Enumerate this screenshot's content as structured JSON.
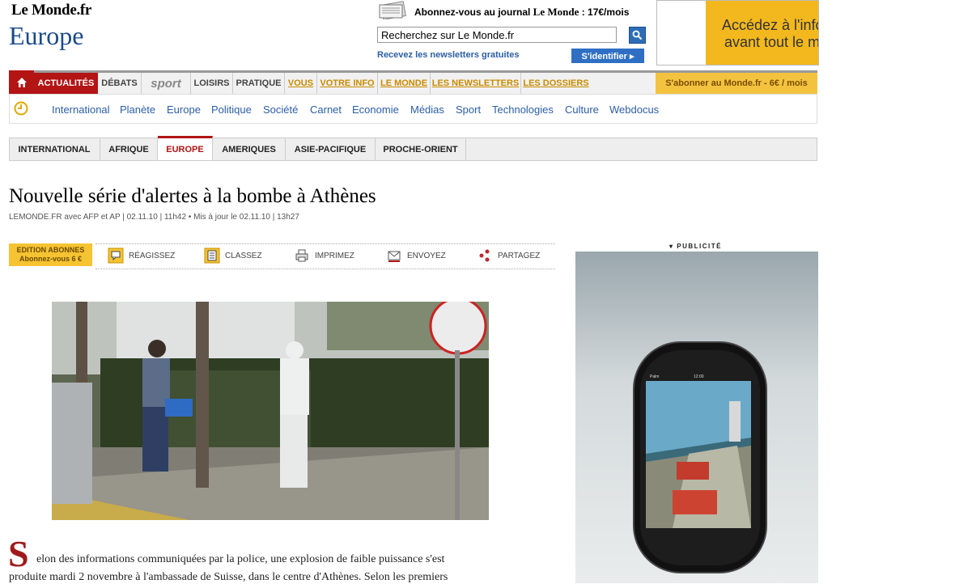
{
  "header": {
    "logo": "Le Monde.fr",
    "section_title": "Europe",
    "subscribe_text_pre": "Abonnez-vous au journal ",
    "subscribe_brand": "Le Monde",
    "subscribe_price": " : 17€/mois",
    "search_value": "Recherchez sur Le Monde.fr",
    "newsletters_link": "Recevez les newsletters gratuites",
    "signin_label": "S'identifier ▸",
    "ad_line1": "Accédez à l'info",
    "ad_line2": "avant tout le m"
  },
  "nav": {
    "items": [
      {
        "label": "ACTUALITÉS"
      },
      {
        "label": "DÉBATS"
      },
      {
        "label": "sport"
      },
      {
        "label": "LOISIRS"
      },
      {
        "label": "PRATIQUE"
      },
      {
        "label": "VOUS"
      },
      {
        "label": "VOTRE INFO"
      },
      {
        "label": "LE MONDE"
      },
      {
        "label": "LES NEWSLETTERS"
      },
      {
        "label": "LES DOSSIERS"
      }
    ],
    "subscribe_button": "S'abonner au Monde.fr - 6€ / mois"
  },
  "subnav": {
    "items": [
      "International",
      "Planète",
      "Europe",
      "Politique",
      "Société",
      "Carnet",
      "Economie",
      "Médias",
      "Sport",
      "Technologies",
      "Culture",
      "Webdocus"
    ]
  },
  "tabs": {
    "items": [
      "INTERNATIONAL",
      "AFRIQUE",
      "EUROPE",
      "AMERIQUES",
      "ASIE-PACIFIQUE",
      "PROCHE-ORIENT"
    ],
    "active": "EUROPE"
  },
  "article": {
    "headline": "Nouvelle série d'alertes à la bombe à Athènes",
    "byline": "LEMONDE.FR avec AFP et AP | 02.11.10 | 11h42  •  Mis à jour le 02.11.10 | 13h27",
    "edition_line1": "EDITION ABONNES",
    "edition_line2": "Abonnez-vous 6 €",
    "tools": [
      "RÉAGISSEZ",
      "CLASSEZ",
      "IMPRIMEZ",
      "ENVOYEZ",
      "PARTAGEZ"
    ],
    "dropcap": "S",
    "body_line1": "elon des informations communiquées par la police, une explosion de faible puissance s'est",
    "body_line2": "produite mardi 2 novembre à l'ambassade de Suisse, dans le centre d'Athènes. Selon les premiers"
  },
  "sidebar": {
    "pub_label": "▾ PUBLICITÉ",
    "phone_carrier": "Palm",
    "phone_time": "12:00"
  },
  "colors": {
    "brand_red": "#b31414",
    "link_blue": "#2b5ea6",
    "accent_yellow": "#f3c340"
  }
}
